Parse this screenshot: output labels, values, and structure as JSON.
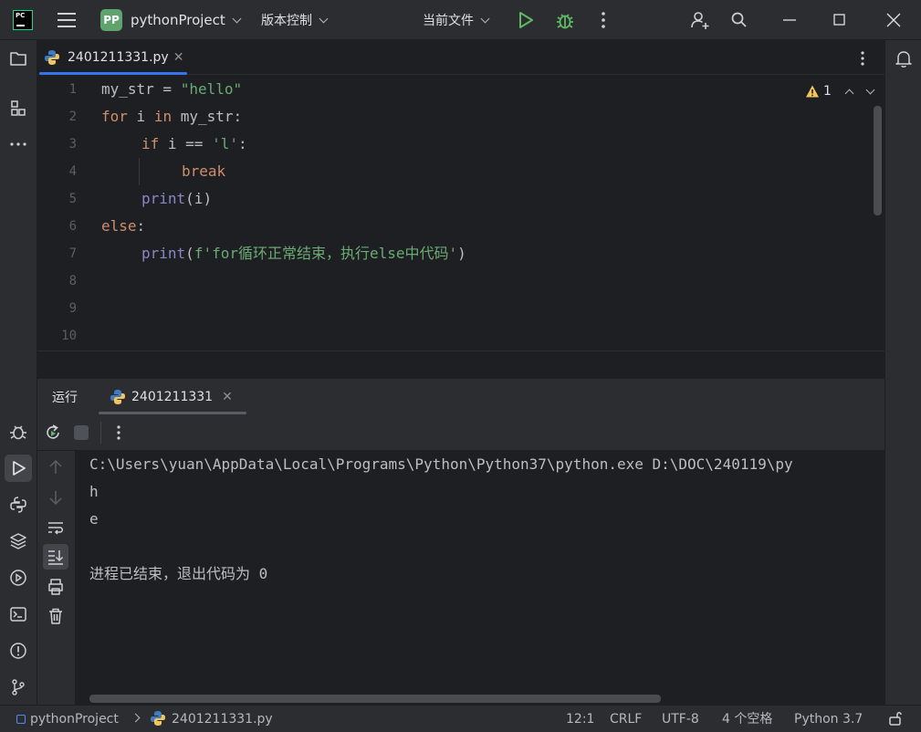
{
  "titlebar": {
    "logo_text": "PC",
    "project_badge": "PP",
    "project_name": "pythonProject",
    "vcs_label": "版本控制",
    "run_config": "当前文件"
  },
  "editor": {
    "tab_label": "2401211331.py",
    "warnings": "1",
    "line_numbers": [
      "1",
      "2",
      "3",
      "4",
      "5",
      "6",
      "7",
      "8",
      "9",
      "10"
    ],
    "code": {
      "l1_var": "my_str",
      "l1_eq": " = ",
      "l1_str": "\"hello\"",
      "l2_for": "for",
      "l2_i": " i ",
      "l2_in": "in",
      "l2_rest": " my_str:",
      "l3_if": "if",
      "l3_mid": " i == ",
      "l3_str": "'l'",
      "l3_colon": ":",
      "l4_break": "break",
      "l5_print": "print",
      "l5_rest": "(i)",
      "l6_else": "else",
      "l6_colon": ":",
      "l7_print": "print",
      "l7_open": "(",
      "l7_str": "f'for循环正常结束，执行else中代码'",
      "l7_close": ")"
    }
  },
  "run_window": {
    "title": "运行",
    "tab_label": "2401211331",
    "output": [
      "C:\\Users\\yuan\\AppData\\Local\\Programs\\Python\\Python37\\python.exe D:\\DOC\\240119\\py",
      "h",
      "e",
      "",
      "进程已结束，退出代码为 0"
    ]
  },
  "statusbar": {
    "project": "pythonProject",
    "file": "2401211331.py",
    "position": "12:1",
    "line_sep": "CRLF",
    "encoding": "UTF-8",
    "indent": "4 个空格",
    "interpreter": "Python 3.7"
  },
  "colors": {
    "accent": "#3574f0",
    "keyword": "#cf8e6d",
    "string": "#6aab73",
    "builtin": "#8888c6",
    "run_green": "#5fb865",
    "warning": "#f2c55c"
  }
}
